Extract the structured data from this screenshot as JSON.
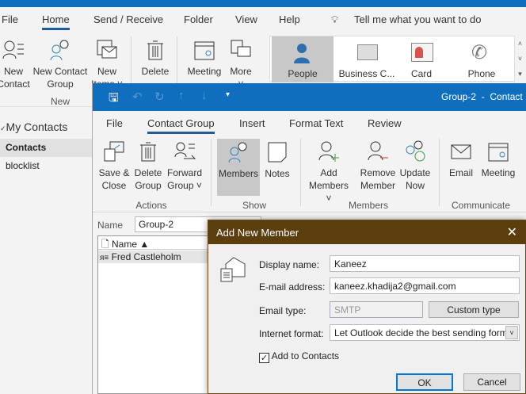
{
  "main_tabs": [
    "File",
    "Home",
    "Send / Receive",
    "Folder",
    "View",
    "Help"
  ],
  "tell_me": "Tell me what you want to do",
  "ribbon": {
    "new_contact": [
      "New",
      "Contact"
    ],
    "new_contact_group": [
      "New Contact",
      "Group"
    ],
    "new_items": [
      "New",
      "Items ˅"
    ],
    "delete": "Delete",
    "meeting": "Meeting",
    "more": [
      "More",
      "˅"
    ],
    "group_new": "New"
  },
  "views": [
    "People",
    "Business C...",
    "Card",
    "Phone"
  ],
  "folders": {
    "header": "My Contacts",
    "items": [
      "Contacts",
      "blocklist"
    ]
  },
  "window": {
    "title": "Group-2  -  Contact",
    "tabs": [
      "File",
      "Contact Group",
      "Insert",
      "Format Text",
      "Review"
    ],
    "buttons": {
      "save_close": [
        "Save &",
        "Close"
      ],
      "delete_group": [
        "Delete",
        "Group"
      ],
      "forward_group": [
        "Forward",
        "Group ˅"
      ],
      "members": "Members",
      "notes": "Notes",
      "add_members": [
        "Add",
        "Members ˅"
      ],
      "remove_member": [
        "Remove",
        "Member"
      ],
      "update_now": [
        "Update",
        "Now"
      ],
      "email": "Email",
      "meeting": "Meeting"
    },
    "groups": [
      "Actions",
      "Show",
      "Members",
      "Communicate"
    ],
    "name_label": "Name",
    "name_value": "Group-2",
    "list_header": "Name ▲",
    "members": [
      "Fred Castleholm"
    ]
  },
  "dialog": {
    "title": "Add New Member",
    "display_name_label": "Display name:",
    "display_name": "Kaneez",
    "email_label": "E-mail address:",
    "email": "kaneez.khadija2@gmail.com",
    "email_type_label": "Email type:",
    "email_type": "SMTP",
    "custom_type": "Custom type",
    "internet_format_label": "Internet format:",
    "internet_format": "Let Outlook decide the best sending form",
    "add_to_contacts": "Add to Contacts",
    "add_to_contacts_checked": true,
    "ok": "OK",
    "cancel": "Cancel"
  }
}
